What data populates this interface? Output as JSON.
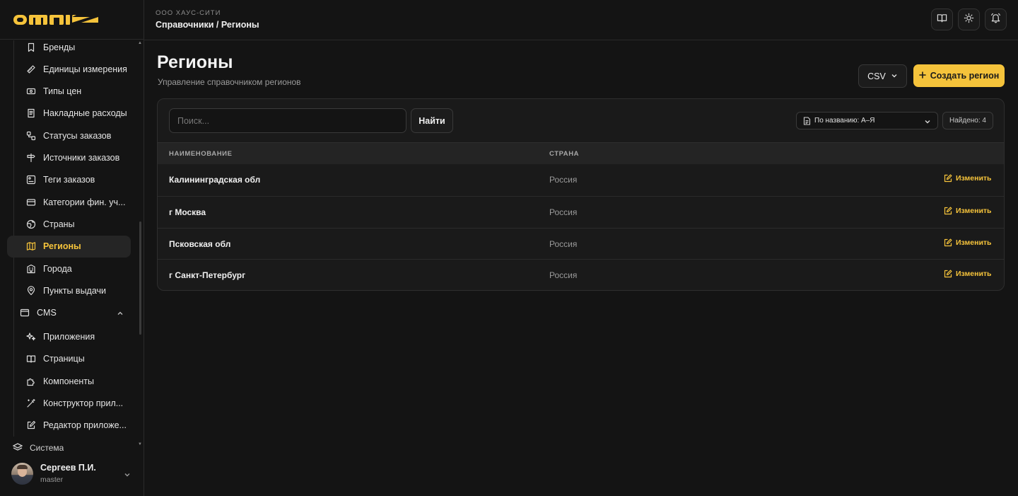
{
  "brand": {
    "logo_text": "OMNIZ",
    "accent": "#f5c33b"
  },
  "header": {
    "company": "ООО ХАУС-СИТИ",
    "breadcrumb": "Справочники / Регионы"
  },
  "sidebar": {
    "items": [
      {
        "label": "Бренды",
        "icon": "bookmark-icon"
      },
      {
        "label": "Единицы измерения",
        "icon": "ruler-icon"
      },
      {
        "label": "Типы цен",
        "icon": "banknote-icon"
      },
      {
        "label": "Накладные расходы",
        "icon": "receipt-icon"
      },
      {
        "label": "Статусы заказов",
        "icon": "workflow-icon"
      },
      {
        "label": "Источники заказов",
        "icon": "signpost-icon"
      },
      {
        "label": "Теги заказов",
        "icon": "tag-box-icon"
      },
      {
        "label": "Категории фин. уч...",
        "icon": "credit-card-icon"
      },
      {
        "label": "Страны",
        "icon": "globe-icon"
      },
      {
        "label": "Регионы",
        "icon": "map-icon",
        "active": true
      },
      {
        "label": "Города",
        "icon": "building-icon"
      },
      {
        "label": "Пункты выдачи",
        "icon": "map-pin-icon"
      }
    ],
    "cms_group": {
      "label": "CMS",
      "icon": "browser-window-icon"
    },
    "cms_items": [
      {
        "label": "Приложения",
        "icon": "sparkles-icon"
      },
      {
        "label": "Страницы",
        "icon": "book-open-icon"
      },
      {
        "label": "Компоненты",
        "icon": "puzzle-icon"
      },
      {
        "label": "Конструктор прил...",
        "icon": "magic-wand-icon"
      },
      {
        "label": "Редактор приложе...",
        "icon": "edit-square-icon"
      }
    ],
    "partial_group": {
      "label": "Система"
    },
    "user": {
      "name": "Сергеев П.И.",
      "role": "master"
    }
  },
  "main": {
    "title": "Регионы",
    "subtitle": "Управление справочником регионов",
    "csv_label": "CSV",
    "create_label": "Создать регион",
    "search": {
      "placeholder": "Поиск...",
      "value": ""
    },
    "find_label": "Найти",
    "sort": {
      "selected": "По названию: А–Я"
    },
    "found_label": "Найдено: 4",
    "columns": [
      "НАИМЕНОВАНИЕ",
      "СТРАНА"
    ],
    "edit_label": "Изменить",
    "rows": [
      {
        "name": "Калининградская обл",
        "country": "Россия"
      },
      {
        "name": "г Москва",
        "country": "Россия"
      },
      {
        "name": "Псковская обл",
        "country": "Россия"
      },
      {
        "name": "г Санкт-Петербург",
        "country": "Россия"
      }
    ]
  }
}
